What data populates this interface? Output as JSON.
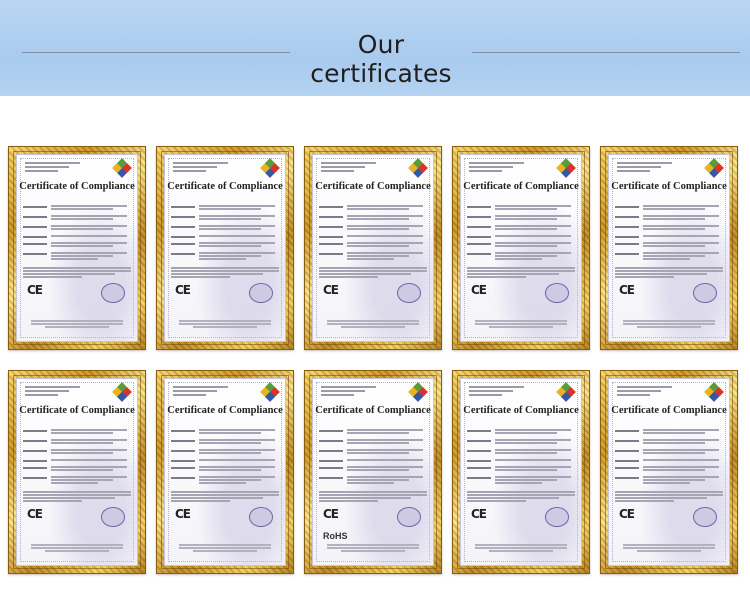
{
  "header": {
    "title": "Our certificates"
  },
  "certificate": {
    "title": "Certificate of Compliance",
    "ce_mark": "CE",
    "rohs_mark": "RoHS"
  },
  "certificates": [
    {
      "id": 1,
      "marks": [
        "CE"
      ]
    },
    {
      "id": 2,
      "marks": [
        "CE"
      ]
    },
    {
      "id": 3,
      "marks": [
        "CE"
      ]
    },
    {
      "id": 4,
      "marks": [
        "CE"
      ]
    },
    {
      "id": 5,
      "marks": [
        "CE"
      ]
    },
    {
      "id": 6,
      "marks": [
        "CE"
      ]
    },
    {
      "id": 7,
      "marks": [
        "CE"
      ]
    },
    {
      "id": 8,
      "marks": [
        "CE",
        "RoHS"
      ]
    },
    {
      "id": 9,
      "marks": [
        "CE"
      ]
    },
    {
      "id": 10,
      "marks": [
        "CE"
      ]
    }
  ]
}
